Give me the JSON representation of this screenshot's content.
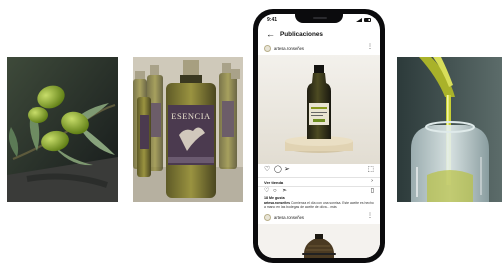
{
  "phone": {
    "status_time": "9:41",
    "header": {
      "back_icon": "arrow-left-icon",
      "title": "Publicaciones"
    },
    "post1": {
      "username": "artesa.ronseñes",
      "more_icon": "more-dots-icon",
      "product_caption": "Aceite de Oliva Virgen Extra",
      "ver_label": "Ver tienda",
      "likes": "18 Me gusta",
      "caption_user": "artesa.ronseñes",
      "caption_text": "Comienza el día con una sonrisa. Este aceite es hecho a mano en las bodegas de aceite de oliva... más",
      "actions": [
        "heart-icon",
        "comment-icon",
        "send-icon",
        "bookmark-icon"
      ]
    },
    "post2": {
      "username": "artesa.ronseñes",
      "more_icon": "more-dots-icon"
    }
  },
  "photos": [
    {
      "name": "olives-branch-photo"
    },
    {
      "name": "esencia-bottles-photo",
      "label": "ESENCIA"
    },
    {
      "name": "oil-pour-photo"
    }
  ],
  "colors": {
    "oil": "#8a9a1e",
    "olive": "#6f8f22",
    "bottle_dark": "#2b2a1c",
    "label_purple": "#4b3a4f"
  }
}
